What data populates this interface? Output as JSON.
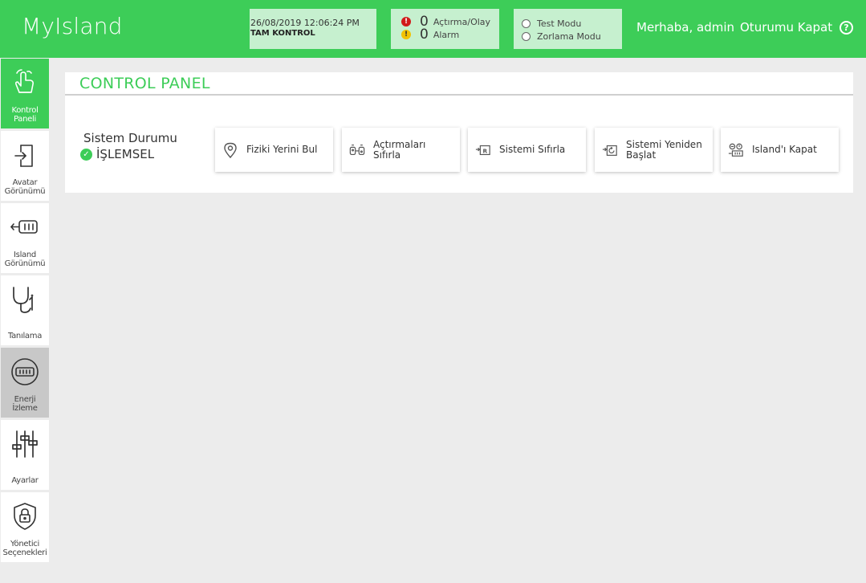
{
  "app": {
    "title": "MyIsland"
  },
  "header": {
    "datetime": "26/08/2019 12:06:24 PM",
    "control_mode": "TAM KONTROL",
    "alarms": [
      {
        "count": "0",
        "label": "Açtırma/Olay",
        "color": "#d11a1a",
        "symbol": "!"
      },
      {
        "count": "0",
        "label": "Alarm",
        "color": "#f2c200",
        "symbol": "!"
      }
    ],
    "modes": [
      {
        "label": "Test Modu"
      },
      {
        "label": "Zorlama Modu"
      }
    ],
    "greeting": "Merhaba, admin",
    "logout": "Oturumu Kapat",
    "help_symbol": "?"
  },
  "sidebar": {
    "items": [
      {
        "label": "Kontrol Paneli",
        "icon": "hand-pointer-icon",
        "state": "active"
      },
      {
        "label": "Avatar Görünümü",
        "icon": "login-door-icon",
        "state": "normal"
      },
      {
        "label": "Island Görünümü",
        "icon": "island-module-icon",
        "state": "normal"
      },
      {
        "label": "Tanılama",
        "icon": "stethoscope-icon",
        "state": "normal"
      },
      {
        "label": "Enerji İzleme",
        "icon": "energy-meter-icon",
        "state": "selected"
      },
      {
        "label": "Ayarlar",
        "icon": "sliders-icon",
        "state": "normal"
      },
      {
        "label": "Yönetici Seçenekleri",
        "icon": "shield-lock-icon",
        "state": "normal"
      }
    ]
  },
  "panel": {
    "title": "CONTROL PANEL",
    "status_label": "Sistem Durumu",
    "status_value": "İŞLEMSEL",
    "status_icon": "check-circle-icon",
    "actions": [
      {
        "label": "Fiziki Yerini Bul",
        "icon": "location-pin-icon"
      },
      {
        "label": "Açtırmaları Sıfırla",
        "icon": "reset-trips-icon"
      },
      {
        "label": "Sistemi Sıfırla",
        "icon": "system-reset-icon"
      },
      {
        "label": "Sistemi Yeniden Başlat",
        "icon": "restart-icon"
      },
      {
        "label": "Island'ı Kapat",
        "icon": "island-off-icon"
      }
    ]
  },
  "colors": {
    "brand": "#3dcd58",
    "header_box": "#c6f0cf",
    "background": "#ececec",
    "selected": "#c8c8c8"
  }
}
